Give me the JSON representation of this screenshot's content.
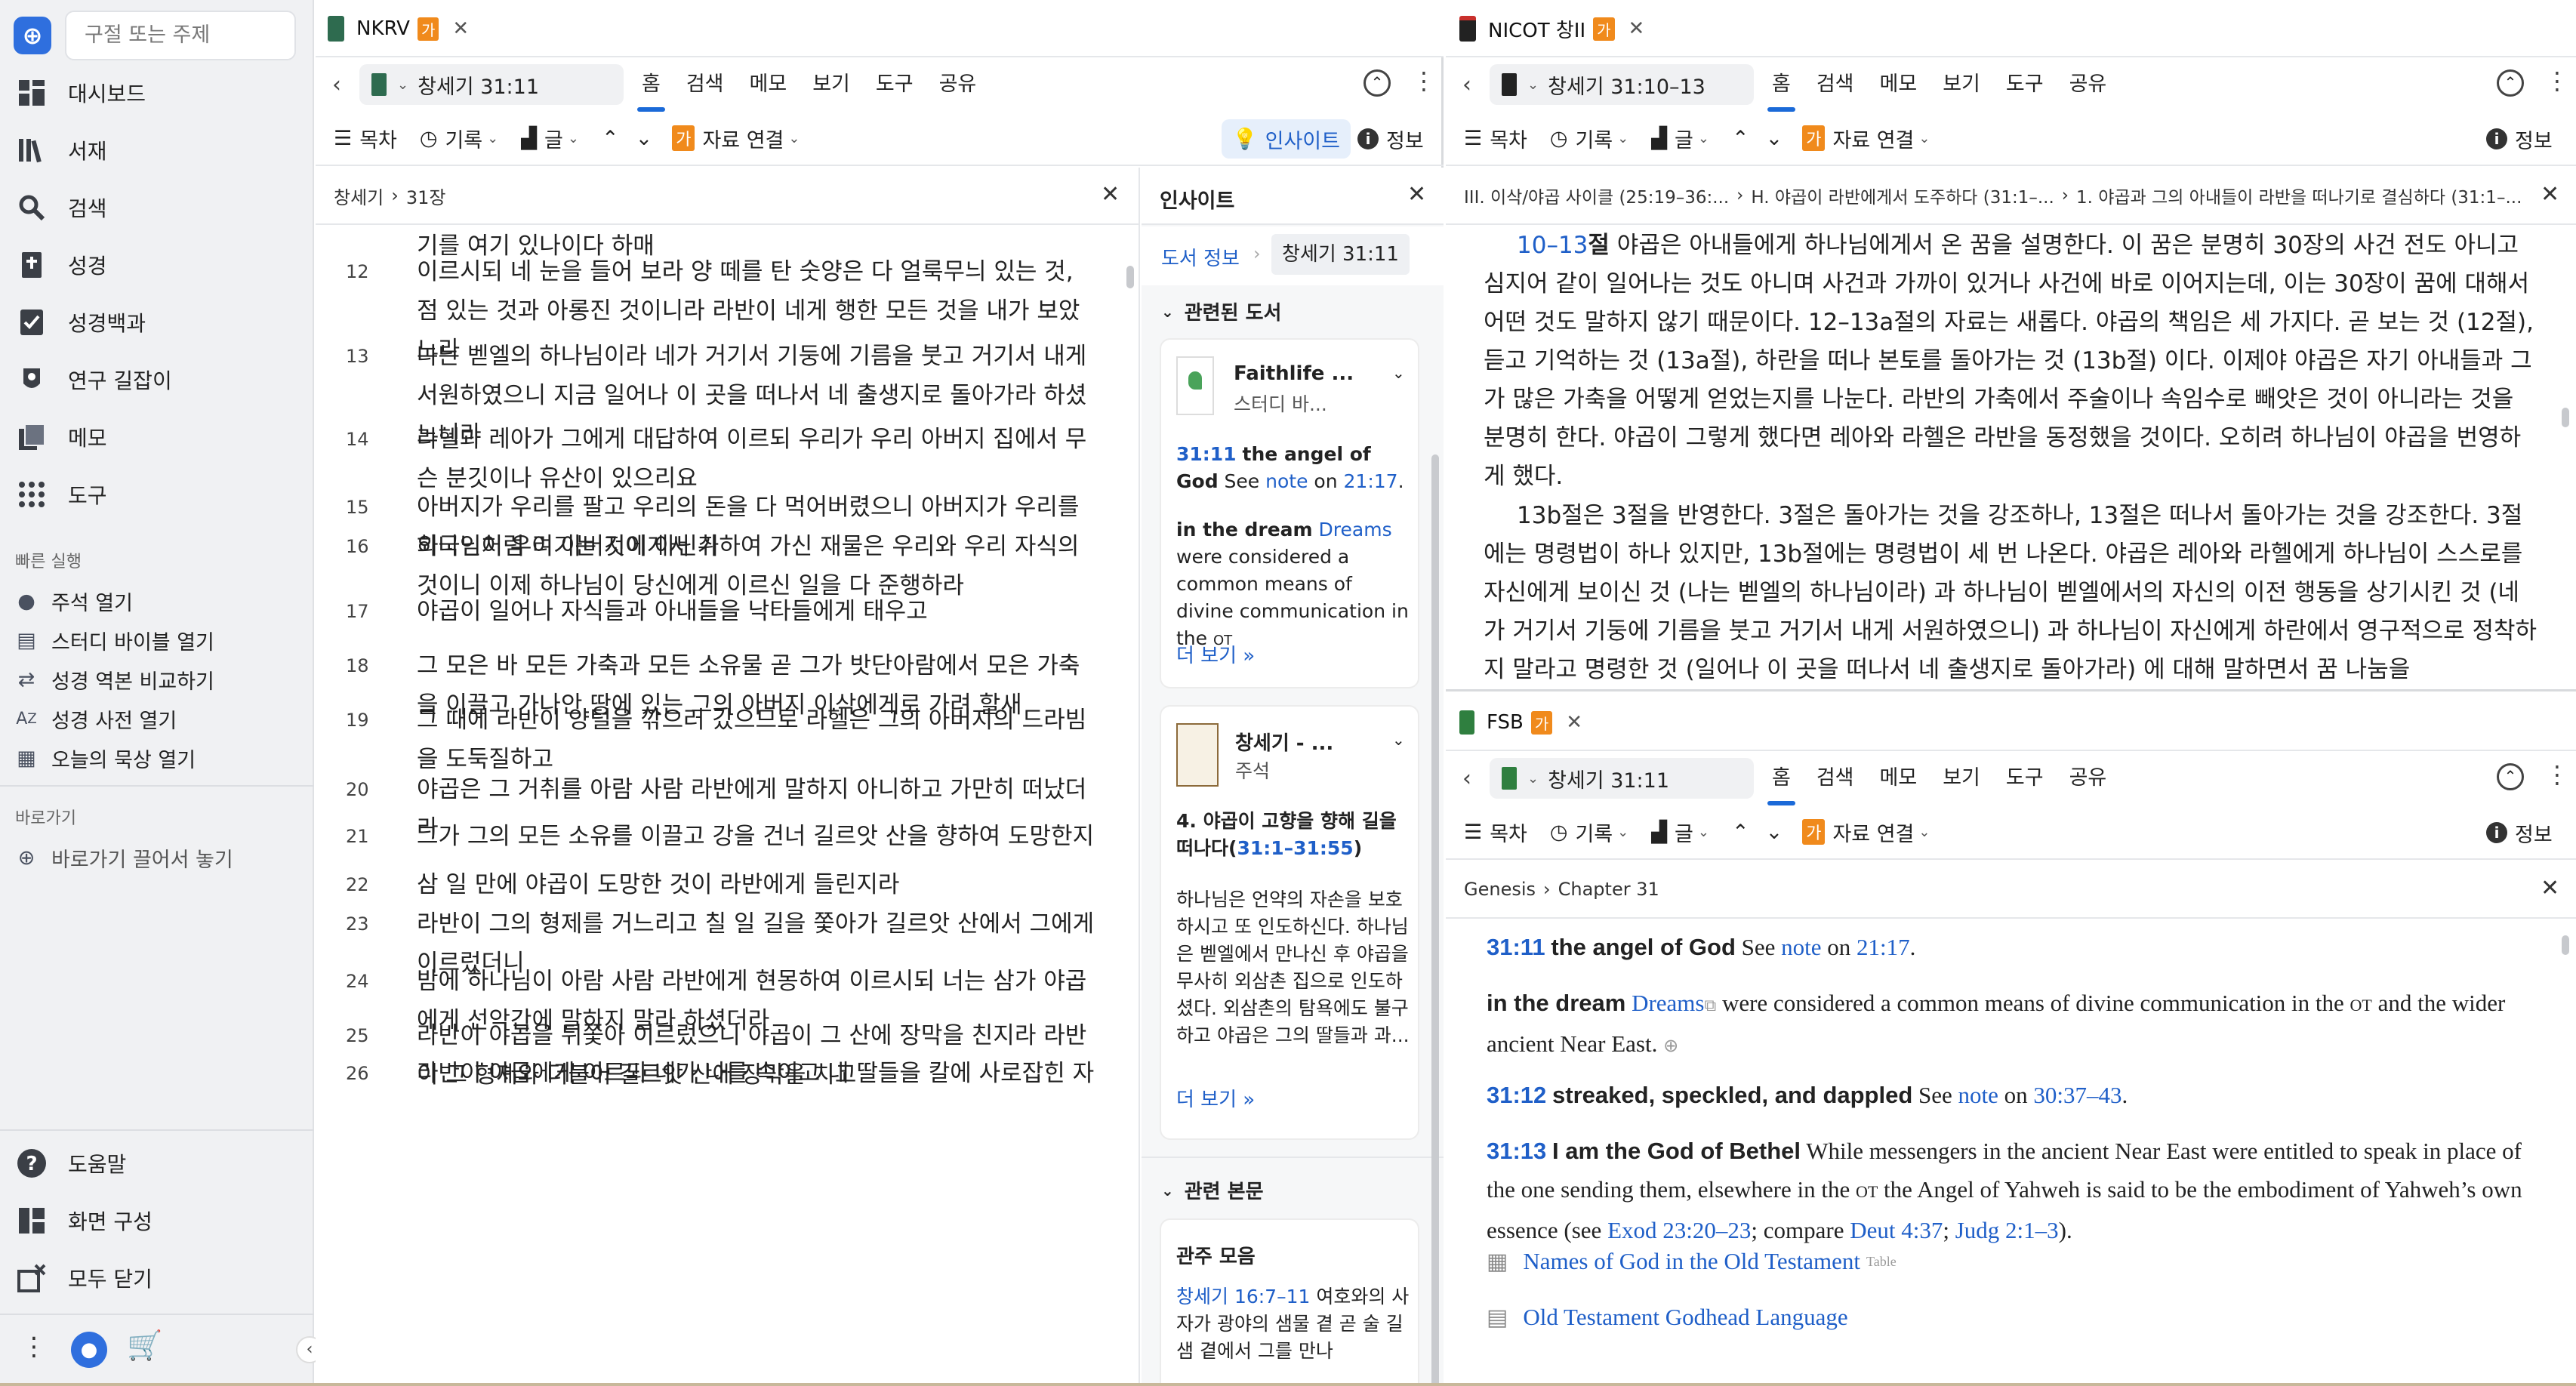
{
  "sidebar": {
    "search_placeholder": "구절 또는 주제",
    "nav": [
      {
        "label": "대시보드",
        "icon": "dashboard-icon"
      },
      {
        "label": "서재",
        "icon": "library-icon"
      },
      {
        "label": "검색",
        "icon": "search-icon"
      },
      {
        "label": "성경",
        "icon": "bible-icon"
      },
      {
        "label": "성경백과",
        "icon": "factbook-icon"
      },
      {
        "label": "연구 길잡이",
        "icon": "guide-icon"
      },
      {
        "label": "메모",
        "icon": "notes-icon"
      },
      {
        "label": "도구",
        "icon": "tools-icon"
      }
    ],
    "quick_title": "빠른 실행",
    "quick": [
      {
        "label": "주석 열기",
        "icon": "comment-icon"
      },
      {
        "label": "스터디 바이블 열기",
        "icon": "book-icon"
      },
      {
        "label": "성경 역본 비교하기",
        "icon": "compare-icon"
      },
      {
        "label": "성경 사전 열기",
        "icon": "dictionary-icon"
      },
      {
        "label": "오늘의 묵상 열기",
        "icon": "calendar-icon"
      }
    ],
    "shortcut_title": "바로가기",
    "shortcut_drop": "바로가기 끌어서 놓기",
    "bottom": [
      {
        "label": "도움말",
        "icon": "help-icon"
      },
      {
        "label": "화면 구성",
        "icon": "layout-icon"
      },
      {
        "label": "모두 닫기",
        "icon": "close-all-icon"
      }
    ]
  },
  "left_panel": {
    "tab_title": "NKRV",
    "badge": "가",
    "reference": "창세기 31:11",
    "menu": [
      "홈",
      "검색",
      "메모",
      "보기",
      "도구",
      "공유"
    ],
    "toolbar": {
      "toc": "목차",
      "history": "기록",
      "text": "글",
      "link": "자료 연결",
      "insights": "인사이트",
      "info": "정보"
    },
    "crumb_book": "창세기",
    "crumb_sep": "›",
    "crumb_chapter": "31장",
    "top_line": "기를 여기 있나이다 하매",
    "verses": [
      {
        "n": "12",
        "t": "이르시되 네 눈을 들어 보라 양 떼를 탄 숫양은 다 얼룩무늬 있는 것, 점 있는 것과 아롱진 것이니라 라반이 네게 행한 모든 것을 내가 보았노라"
      },
      {
        "n": "13",
        "t": "나는 벧엘의 하나님이라 네가 거기서 기둥에 기름을 붓고 거기서 내게 서원하였으니 지금 일어나 이 곳을 떠나서 네 출생지로 돌아가라 하셨느니라"
      },
      {
        "n": "14",
        "t": "라헬과 레아가 그에게 대답하여 이르되 우리가 우리 아버지 집에서 무슨 분깃이나 유산이 있으리요"
      },
      {
        "n": "15",
        "t": "아버지가 우리를 팔고 우리의 돈을 다 먹어버렸으니 아버지가 우리를 외국인처럼 여기는 것이 아닌가"
      },
      {
        "n": "16",
        "t": "하나님이 우리 아버지에게서 취하여 가신 재물은 우리와 우리 자식의 것이니 이제 하나님이 당신에게 이르신 일을 다 준행하라"
      },
      {
        "n": "17",
        "t": "야곱이 일어나 자식들과 아내들을 낙타들에게 태우고"
      },
      {
        "n": "18",
        "t": "그 모은 바 모든 가축과 모든 소유물 곧 그가 밧단아람에서 모은 가축을 이끌고 가나안 땅에 있는 그의 아버지 이삭에게로 가려 할새"
      },
      {
        "n": "19",
        "t": "그 때에 라반이 양털을 깎으러 갔으므로 라헬은 그의 아버지의 드라빔을 도둑질하고"
      },
      {
        "n": "20",
        "t": "야곱은 그 거취를 아람 사람 라반에게 말하지 아니하고 가만히 떠났더라"
      },
      {
        "n": "21",
        "t": "그가 그의 모든 소유를 이끌고 강을 건너 길르앗 산을 향하여 도망한지"
      },
      {
        "n": "22",
        "t": "삼 일 만에 야곱이 도망한 것이 라반에게 들린지라"
      },
      {
        "n": "23",
        "t": "라반이 그의 형제를 거느리고 칠 일 길을 쫓아가 길르앗 산에서 그에게 이르렀더니"
      },
      {
        "n": "24",
        "t": "밤에 하나님이 아람 사람 라반에게 현몽하여 이르시되 너는 삼가 야곱에게 선악간에 말하지 말라 하셨더라"
      },
      {
        "n": "25",
        "t": "라반이 야곱을 뒤쫓아 이르렀으니 야곱이 그 산에 장막을 친지라 라반이 그 형제와 더불어 길르앗 산에 장막을 치고"
      },
      {
        "n": "26",
        "t": "라반이 야곱에게 이르되 네가 나를 속이고 내 딸들을 칼에 사로잡힌 자"
      }
    ]
  },
  "insights": {
    "title": "인사이트",
    "crumb_info": "도서 정보",
    "crumb_ref": "창세기 31:11",
    "related_books": "관련된 도서",
    "card1_title": "Faithlife ...",
    "card1_sub": "스터디 바...",
    "card1_ref": "31:11",
    "card1_head": "the angel of God",
    "card1_see": "See",
    "card1_note": "note",
    "card1_on": "on",
    "card1_link": "21:17",
    "card1_tail": ".",
    "card1_dream": "in the dream",
    "card1_dreams": "Dreams",
    "card1_body": "were considered a common means of divine communication in the",
    "card1_ot": "OT",
    "more": "더 보기 »",
    "card2_title": "창세기 - ...",
    "card2_sub": "주석",
    "card2_head": "4. 야곱이 고향을 향해 길을 떠나다(",
    "card2_head_link": "31:1–31:55",
    "card2_head_end": ")",
    "card2_body": "하나님은 언약의 자손을 보호하시고 또 인도하신다. 하나님은 벧엘에서 만나신 후 야곱을 무사히 외삼촌 집으로 인도하셨다. 외삼촌의 탐욕에도 불구하고 야곱은 그의 딸들과 과...",
    "related_passages": "관련 본문",
    "card3_title": "관주 모음",
    "card3_ref": "창세기 16:7–11",
    "card3_body": "여호와의 사자가 광야의 샘물 곁 곧 술 길 샘 곁에서 그를 만나"
  },
  "nicot": {
    "tab_title": "NICOT 창II",
    "badge": "가",
    "reference": "창세기 31:10–13",
    "menu": [
      "홈",
      "검색",
      "메모",
      "보기",
      "도구",
      "공유"
    ],
    "toolbar": {
      "toc": "목차",
      "history": "기록",
      "text": "글",
      "link": "자료 연결",
      "info": "정보"
    },
    "crumb1": "III. 이삭/야곱 사이클 (25:19–36:...",
    "crumb2": "H. 야곱이 라반에게서 도주하다 (31:1–...",
    "crumb3": "1. 야곱과 그의 아내들이 라반을 떠나기로 결심하다 (31:1–...",
    "p1_ref": "10–13",
    "p1_ref_suffix": "절",
    "p1_text": "야곱은 아내들에게 하나님에게서 온 꿈을 설명한다. 이 꿈은 분명히 30장의 사건 전도 아니고 심지어 같이 일어나는 것도 아니며 사건과 가까이 있거나 사건에 바로 이어지는데, 이는 30장이 꿈에 대해서 어떤 것도 말하지 않기 때문이다. 12–13a절의 자료는 새롭다. 야곱의 책임은 세 가지다. 곧 보는 것 (12절), 듣고 기억하는 것 (13a절), 하란을 떠나 본토를 돌아가는 것 (13b절) 이다. 이제야 야곱은 자기 아내들과 그가 많은 가축을 어떻게 얻었는지를 나눈다. 라반의 가축에서 주술이나 속임수로 빼앗은 것이 아니라는 것을 분명히 한다. 야곱이 그렇게 했다면 레아와 라헬은 라반을 동정했을 것이다. 오히려 하나님이 야곱을 번영하게 했다.",
    "p2_text": "13b절은 3절을 반영한다. 3절은 돌아가는 것을 강조하나, 13절은 떠나서 돌아가는 것을 강조한다. 3절에는 명령법이 하나 있지만, 13b절에는 명령법이 세 번 나온다. 야곱은 레아와 라헬에게 하나님이 스스로를 자신에게 보이신 것 (나는 벧엘의 하나님이라) 과 하나님이 벧엘에서의 자신의 이전 행동을 상기시킨 것 (네가 거기서 기둥에 기름을 붓고 거기서 내게 서원하였으니) 과 하나님이 자신에게 하란에서 영구적으로 정착하지 말라고 명령한 것 (일어나 이 곳을 떠나서 네 출생지로 돌아가라) 에 대해 말하면서 꿈 나눔을"
  },
  "fsb": {
    "tab_title": "FSB",
    "badge": "가",
    "reference": "창세기 31:11",
    "menu": [
      "홈",
      "검색",
      "메모",
      "보기",
      "도구",
      "공유"
    ],
    "toolbar": {
      "toc": "목차",
      "history": "기록",
      "text": "글",
      "link": "자료 연결",
      "info": "정보"
    },
    "crumb_book": "Genesis",
    "crumb_chapter": "Chapter 31",
    "n1_ref": "31:11",
    "n1_head": "the angel of God",
    "n1_see": "See",
    "n1_note": "note",
    "n1_on": "on",
    "n1_link": "21:17",
    "n2_head": "in the dream",
    "n2_link": "Dreams",
    "n2_body": "were considered a common means of divine communication in the",
    "n2_ot": "OT",
    "n2_tail": "and the wider ancient Near East.",
    "n3_ref": "31:12",
    "n3_head": "streaked, speckled, and dappled",
    "n3_see": "See",
    "n3_note": "note",
    "n3_on": "on",
    "n3_link": "30:37–43",
    "n4_ref": "31:13",
    "n4_head": "I am the God of Bethel",
    "n4_body1": "While messengers in the ancient Near East were entitled to speak in place of the one sending them, elsewhere in the",
    "n4_ot": "OT",
    "n4_body2": "the Angel of Yahweh is said to be the embodiment of Yahweh’s own essence (see",
    "n4_l1": "Exod 23:20–23",
    "n4_sep1": "; compare",
    "n4_l2": "Deut 4:37",
    "n4_sep2": ";",
    "n4_l3": "Judg 2:1–3",
    "n4_end": ").",
    "link1": "Names of God in the Old Testament",
    "link1_tag": "Table",
    "link2": "Old Testament Godhead Language"
  }
}
